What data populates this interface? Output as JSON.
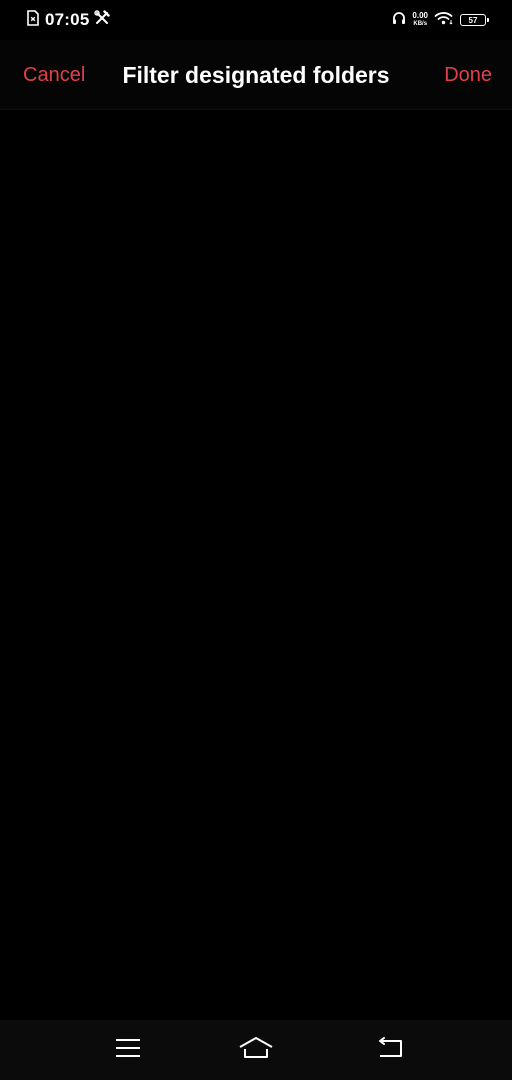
{
  "status_bar": {
    "time": "07:05",
    "net_speed_value": "0.00",
    "net_speed_unit": "KB/s",
    "battery_level": "57",
    "icons": [
      "sim-card-icon",
      "tools-icon",
      "headphones-icon",
      "wifi-icon",
      "battery-icon"
    ]
  },
  "header": {
    "cancel_label": "Cancel",
    "title": "Filter designated folders",
    "done_label": "Done"
  },
  "nav_bar": {
    "icons": [
      "menu-icon",
      "home-icon",
      "back-icon"
    ]
  },
  "colors": {
    "accent": "#e0404a",
    "background": "#000000",
    "text": "#ffffff",
    "nav_background": "#0b0b0b"
  }
}
